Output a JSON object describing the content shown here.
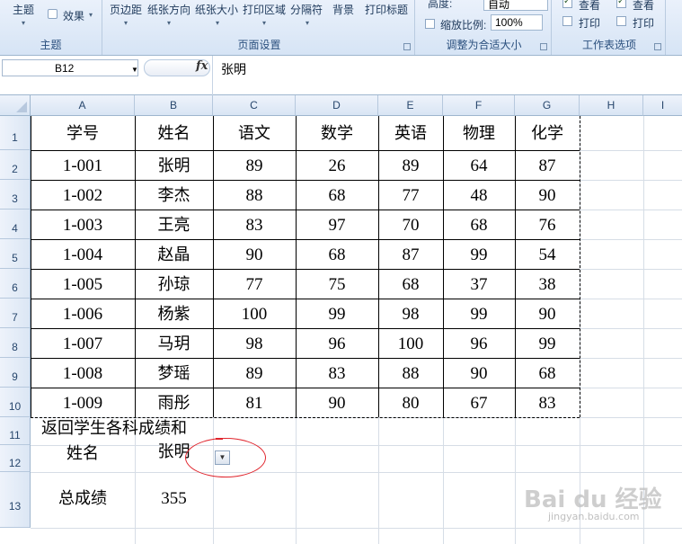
{
  "ribbon": {
    "groups": [
      {
        "title": "主题",
        "items": [
          "主题",
          "效果"
        ]
      },
      {
        "title": "页面设置",
        "items": [
          "页边距",
          "纸张方向",
          "纸张大小",
          "打印区域",
          "分隔符",
          "背景",
          "打印标题"
        ]
      },
      {
        "title": "调整为合适大小",
        "height_label": "高度:",
        "height_value": "自动",
        "scale_label": "缩放比例:",
        "scale_value": "100%"
      },
      {
        "title": "工作表选项",
        "gridlines_view": "查看",
        "gridlines_print": "打印",
        "headings_view": "查看",
        "headings_print": "打印"
      }
    ]
  },
  "formula_bar": {
    "name_box": "B12",
    "fx_label": "fx",
    "value": "张明"
  },
  "sheet": {
    "columns": [
      "A",
      "B",
      "C",
      "D",
      "E",
      "F",
      "G",
      "H",
      "I"
    ],
    "rows": [
      "1",
      "2",
      "3",
      "4",
      "5",
      "6",
      "7",
      "8",
      "9",
      "10",
      "11",
      "12",
      "13"
    ],
    "table_header": [
      "学号",
      "姓名",
      "语文",
      "数学",
      "英语",
      "物理",
      "化学"
    ],
    "table_rows": [
      [
        "1-001",
        "张明",
        "89",
        "26",
        "89",
        "64",
        "87"
      ],
      [
        "1-002",
        "李杰",
        "88",
        "68",
        "77",
        "48",
        "90"
      ],
      [
        "1-003",
        "王亮",
        "83",
        "97",
        "70",
        "68",
        "76"
      ],
      [
        "1-004",
        "赵晶",
        "90",
        "68",
        "87",
        "99",
        "54"
      ],
      [
        "1-005",
        "孙琼",
        "77",
        "75",
        "68",
        "37",
        "38"
      ],
      [
        "1-006",
        "杨紫",
        "100",
        "99",
        "98",
        "99",
        "90"
      ],
      [
        "1-007",
        "马玥",
        "98",
        "96",
        "100",
        "96",
        "99"
      ],
      [
        "1-008",
        "梦瑶",
        "89",
        "83",
        "88",
        "90",
        "68"
      ],
      [
        "1-009",
        "雨彤",
        "81",
        "90",
        "80",
        "67",
        "83"
      ]
    ],
    "a11": "返回学生各科成绩和",
    "a12": "姓名",
    "b12": "张明",
    "a13": "总成绩",
    "b13": "355"
  },
  "watermark": {
    "logo": "Bai du 经验",
    "url": "jingyan.baidu.com"
  },
  "colors": {
    "accent_red": "#e0242c",
    "ribbon_bg": "#d6e4f5"
  }
}
